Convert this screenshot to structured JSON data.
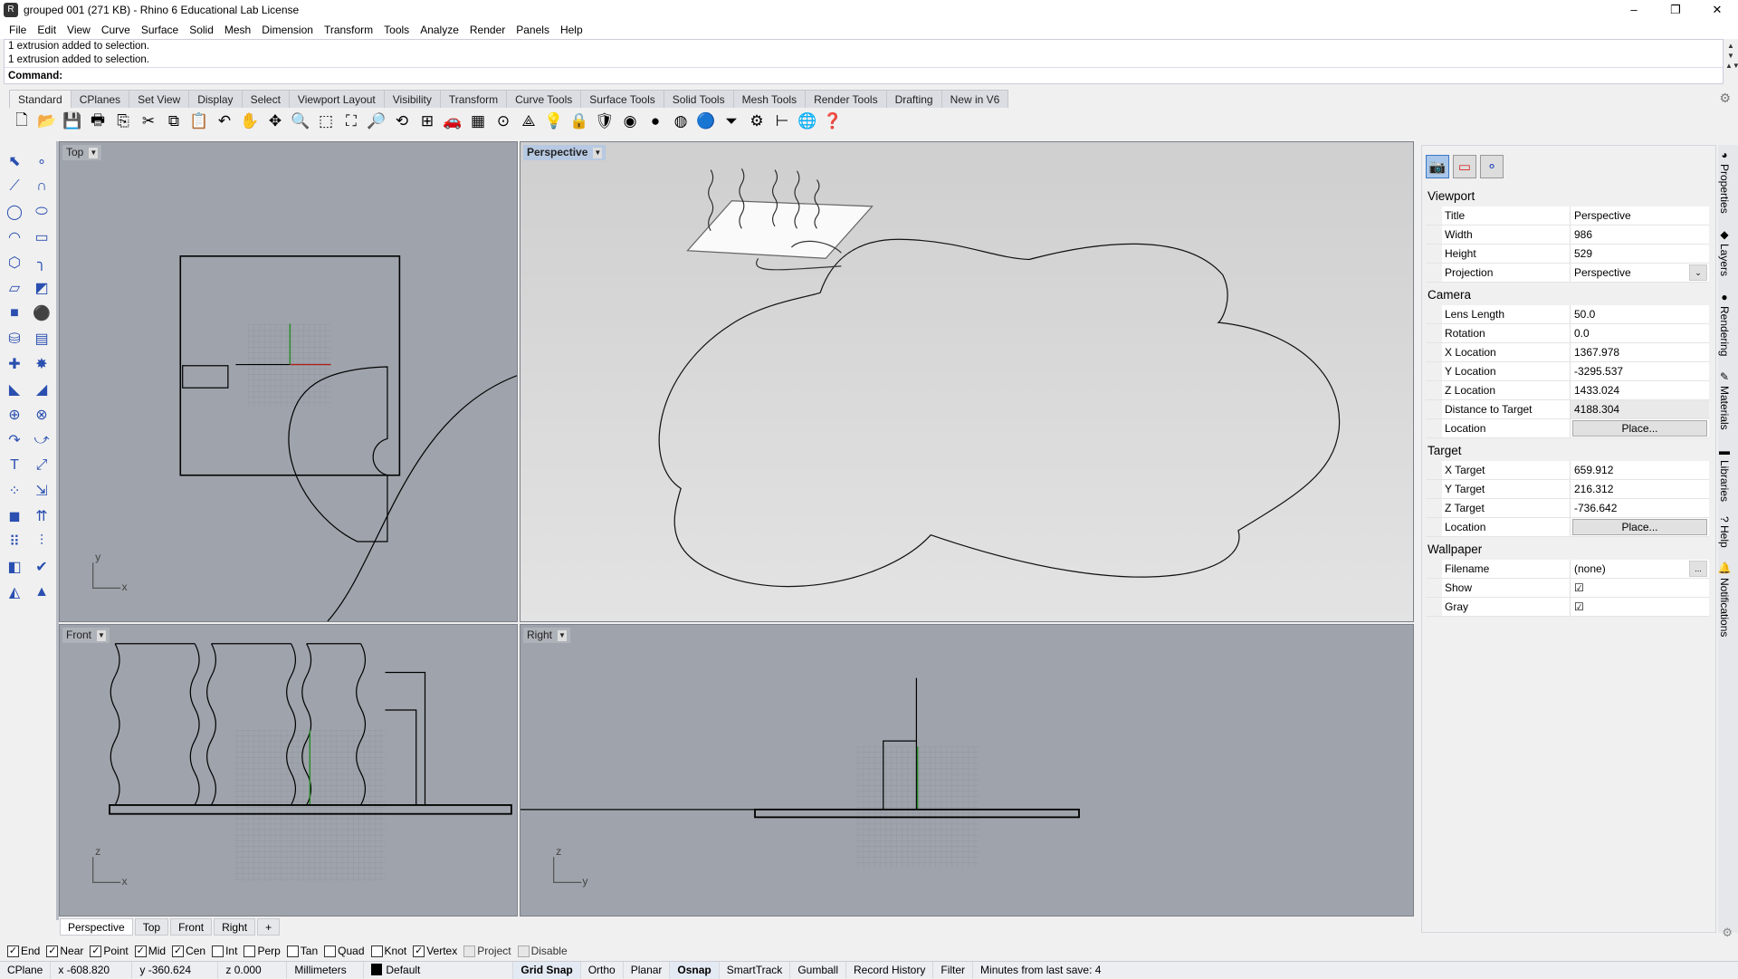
{
  "window": {
    "title": "grouped 001 (271 KB) - Rhino 6 Educational Lab License",
    "controls": [
      "–",
      "❐",
      "✕"
    ]
  },
  "menu": [
    "File",
    "Edit",
    "View",
    "Curve",
    "Surface",
    "Solid",
    "Mesh",
    "Dimension",
    "Transform",
    "Tools",
    "Analyze",
    "Render",
    "Panels",
    "Help"
  ],
  "command": {
    "history": [
      "1 extrusion added to selection.",
      "1 extrusion added to selection."
    ],
    "prompt": "Command:"
  },
  "toolbar_tabs": [
    "Standard",
    "CPlanes",
    "Set View",
    "Display",
    "Select",
    "Viewport Layout",
    "Visibility",
    "Transform",
    "Curve Tools",
    "Surface Tools",
    "Solid Tools",
    "Mesh Tools",
    "Render Tools",
    "Drafting",
    "New in V6"
  ],
  "toolbar_icons": [
    {
      "name": "new-icon",
      "g": "🗋"
    },
    {
      "name": "open-icon",
      "g": "📂"
    },
    {
      "name": "save-icon",
      "g": "💾"
    },
    {
      "name": "print-icon",
      "g": "🖶"
    },
    {
      "name": "import-icon",
      "g": "⎘"
    },
    {
      "name": "cut-icon",
      "g": "✂"
    },
    {
      "name": "copy-icon",
      "g": "⧉"
    },
    {
      "name": "paste-icon",
      "g": "📋"
    },
    {
      "name": "undo-icon",
      "g": "↶"
    },
    {
      "name": "pan-icon",
      "g": "✋"
    },
    {
      "name": "rotate-view-icon",
      "g": "✥"
    },
    {
      "name": "zoom-icon",
      "g": "🔍"
    },
    {
      "name": "zoom-window-icon",
      "g": "⬚"
    },
    {
      "name": "zoom-extents-icon",
      "g": "⛶"
    },
    {
      "name": "zoom-selected-icon",
      "g": "🔎"
    },
    {
      "name": "undo-view-icon",
      "g": "⟲"
    },
    {
      "name": "four-viewports-icon",
      "g": "⊞"
    },
    {
      "name": "car-icon",
      "g": "🚗"
    },
    {
      "name": "grid-icon",
      "g": "▦"
    },
    {
      "name": "osnap-icon",
      "g": "⊙"
    },
    {
      "name": "select-points-icon",
      "g": "⟁"
    },
    {
      "name": "light-icon",
      "g": "💡"
    },
    {
      "name": "lock-icon",
      "g": "🔒"
    },
    {
      "name": "shield-icon",
      "g": "🛡"
    },
    {
      "name": "color-wheel-icon",
      "g": "◉"
    },
    {
      "name": "shaded-sphere-icon",
      "g": "●"
    },
    {
      "name": "rendered-sphere-icon",
      "g": "◍"
    },
    {
      "name": "blue-sphere-icon",
      "g": "🔵"
    },
    {
      "name": "filter-icon",
      "g": "⏷"
    },
    {
      "name": "options-gear-icon",
      "g": "⚙"
    },
    {
      "name": "dimension-icon",
      "g": "⊢"
    },
    {
      "name": "globe-icon",
      "g": "🌐"
    },
    {
      "name": "help-icon",
      "g": "❓"
    }
  ],
  "left_tools": [
    "select-icon",
    "point-icon",
    "polyline-icon",
    "curve-icon",
    "circle-icon",
    "ellipse-icon",
    "arc-icon",
    "rectangle-icon",
    "polygon-icon",
    "fillet-icon",
    "surface-corners-icon",
    "surface-edge-icon",
    "box-icon",
    "sphere-icon",
    "cylinder-icon",
    "patch-icon",
    "boolean-union-icon",
    "explode-icon",
    "trim-icon",
    "split-icon",
    "group-icon",
    "ungroup-icon",
    "offset-icon",
    "blend-icon",
    "text-icon",
    "scale-icon",
    "array-icon",
    "align-icon",
    "cage-icon",
    "extrude-icon",
    "grid-array-icon",
    "analyze-icon",
    "rebuild-icon",
    "check-icon",
    "solid-icon",
    "render-icon"
  ],
  "left_glyphs": [
    "⬉",
    "∘",
    "⟋",
    "∩",
    "◯",
    "⬭",
    "◠",
    "▭",
    "⬡",
    "╮",
    "▱",
    "◩",
    "■",
    "⚫",
    "⛁",
    "▤",
    "✚",
    "✸",
    "◣",
    "◢",
    "⊕",
    "⊗",
    "↷",
    "⤻",
    "T",
    "⤢",
    "⁘",
    "⇲",
    "◼",
    "⇈",
    "⠿",
    "⫶",
    "◧",
    "✔",
    "◭",
    "▲"
  ],
  "viewports": {
    "top": "Top",
    "perspective": "Perspective",
    "front": "Front",
    "right": "Right",
    "axes": {
      "x": "x",
      "y": "y",
      "z": "z"
    }
  },
  "viewport_tabs": [
    "Perspective",
    "Top",
    "Front",
    "Right",
    "+"
  ],
  "osnaps": [
    {
      "label": "End",
      "checked": true
    },
    {
      "label": "Near",
      "checked": true
    },
    {
      "label": "Point",
      "checked": true
    },
    {
      "label": "Mid",
      "checked": true
    },
    {
      "label": "Cen",
      "checked": true
    },
    {
      "label": "Int",
      "checked": false
    },
    {
      "label": "Perp",
      "checked": false
    },
    {
      "label": "Tan",
      "checked": false
    },
    {
      "label": "Quad",
      "checked": false
    },
    {
      "label": "Knot",
      "checked": false
    },
    {
      "label": "Vertex",
      "checked": true
    },
    {
      "label": "Project",
      "checked": false,
      "disabled": true
    },
    {
      "label": "Disable",
      "checked": false,
      "disabled": true
    }
  ],
  "status": {
    "cplane": "CPlane",
    "x": "x -608.820",
    "y": "y -360.624",
    "z": "z 0.000",
    "units": "Millimeters",
    "layer": "Default",
    "grid_snap": "Grid Snap",
    "ortho": "Ortho",
    "planar": "Planar",
    "osnap": "Osnap",
    "smarttrack": "SmartTrack",
    "gumball": "Gumball",
    "record_history": "Record History",
    "filter": "Filter",
    "minutes": "Minutes from last save: 4"
  },
  "properties": {
    "sections": [
      {
        "title": "Viewport",
        "rows": [
          {
            "k": "Title",
            "v": "Perspective"
          },
          {
            "k": "Width",
            "v": "986"
          },
          {
            "k": "Height",
            "v": "529"
          },
          {
            "k": "Projection",
            "v": "Perspective",
            "type": "dropdown"
          }
        ]
      },
      {
        "title": "Camera",
        "rows": [
          {
            "k": "Lens Length",
            "v": "50.0"
          },
          {
            "k": "Rotation",
            "v": "0.0"
          },
          {
            "k": "X Location",
            "v": "1367.978"
          },
          {
            "k": "Y Location",
            "v": "-3295.537"
          },
          {
            "k": "Z Location",
            "v": "1433.024"
          },
          {
            "k": "Distance to Target",
            "v": "4188.304",
            "type": "readonly"
          },
          {
            "k": "Location",
            "v": "Place...",
            "type": "button"
          }
        ]
      },
      {
        "title": "Target",
        "rows": [
          {
            "k": "X Target",
            "v": "659.912"
          },
          {
            "k": "Y Target",
            "v": "216.312"
          },
          {
            "k": "Z Target",
            "v": "-736.642"
          },
          {
            "k": "Location",
            "v": "Place...",
            "type": "button"
          }
        ]
      },
      {
        "title": "Wallpaper",
        "rows": [
          {
            "k": "Filename",
            "v": "(none)",
            "type": "browse",
            "extra": "..."
          },
          {
            "k": "Show",
            "v": "☑",
            "type": "check"
          },
          {
            "k": "Gray",
            "v": "☑",
            "type": "check"
          }
        ]
      }
    ]
  },
  "side_tabs": [
    {
      "label": "Properties",
      "icon": "◕"
    },
    {
      "label": "Layers",
      "icon": "◆"
    },
    {
      "label": "Rendering",
      "icon": "●"
    },
    {
      "label": "Materials",
      "icon": "✎"
    },
    {
      "label": "Libraries",
      "icon": "▬"
    },
    {
      "label": "Help",
      "icon": "?"
    },
    {
      "label": "Notifications",
      "icon": "🔔"
    }
  ]
}
